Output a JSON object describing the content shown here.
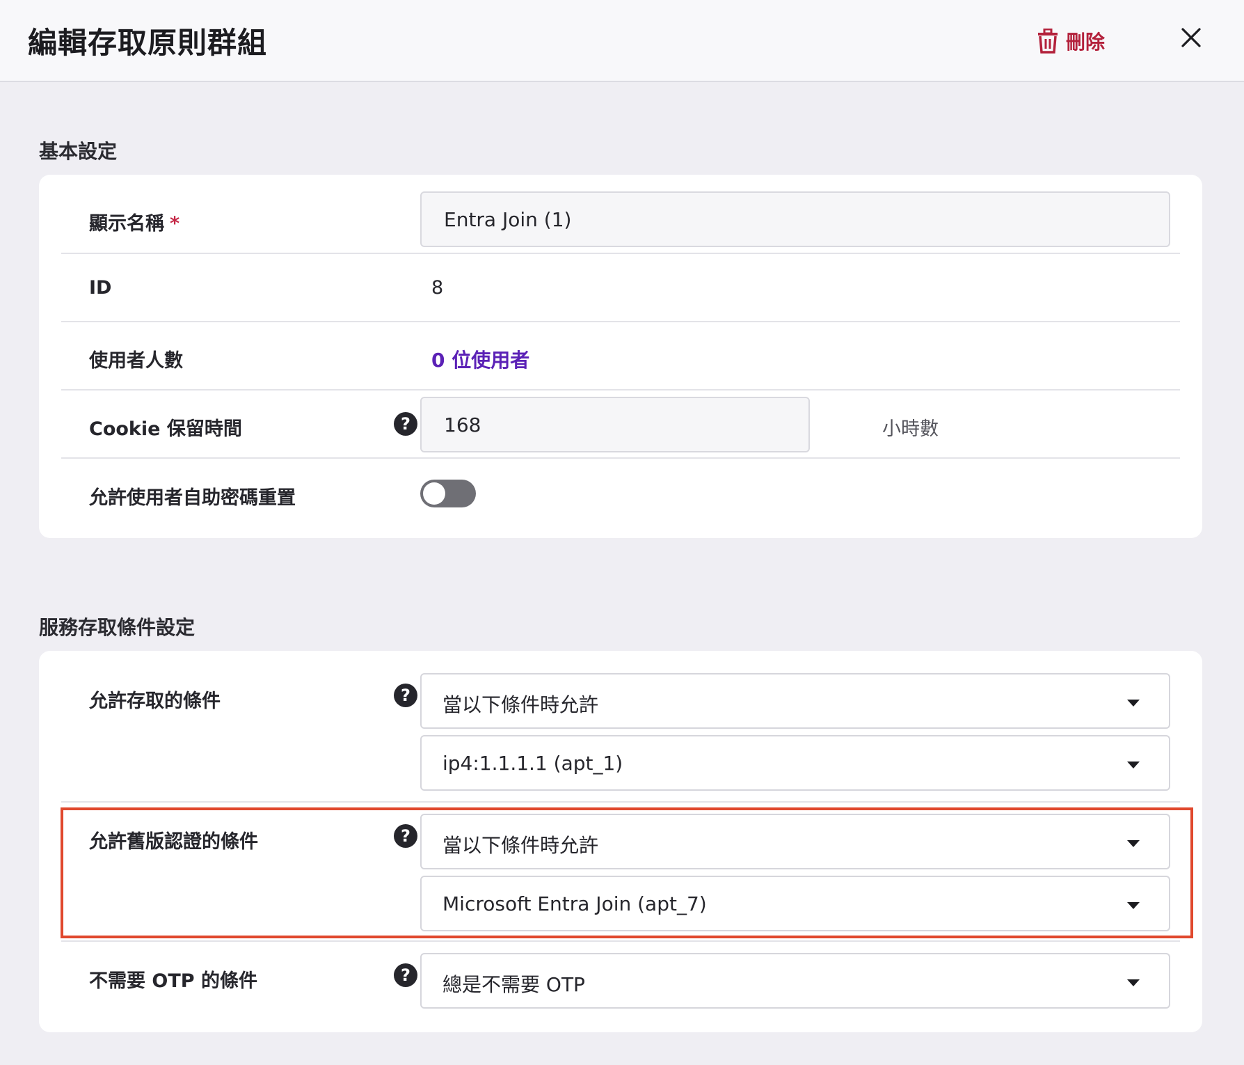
{
  "header": {
    "title": "編輯存取原則群組",
    "delete_label": "刪除",
    "delete_color": "#b3213b"
  },
  "basic": {
    "section_title": "基本設定",
    "display_name_label": "顯示名稱",
    "required_mark": "*",
    "display_name_value": "Entra Join (1)",
    "id_label": "ID",
    "id_value": "8",
    "user_count_label": "使用者人數",
    "user_count_link": "0 位使用者",
    "cookie_label": "Cookie 保留時間",
    "cookie_value": "168",
    "cookie_unit": "小時數",
    "self_reset_label": "允許使用者自助密碼重置",
    "self_reset_enabled": false
  },
  "conditions": {
    "section_title": "服務存取條件設定",
    "access_label": "允許存取的條件",
    "access_mode": "當以下條件時允許",
    "access_condition": "ip4:1.1.1.1 (apt_1)",
    "legacy_label": "允許舊版認證的條件",
    "legacy_mode": "當以下條件時允許",
    "legacy_condition": "Microsoft Entra Join (apt_7)",
    "otp_label": "不需要 OTP 的條件",
    "otp_mode": "總是不需要 OTP"
  },
  "help_glyph": "?",
  "accent_link_color": "#5b21b6",
  "highlight_color": "#e0482d"
}
